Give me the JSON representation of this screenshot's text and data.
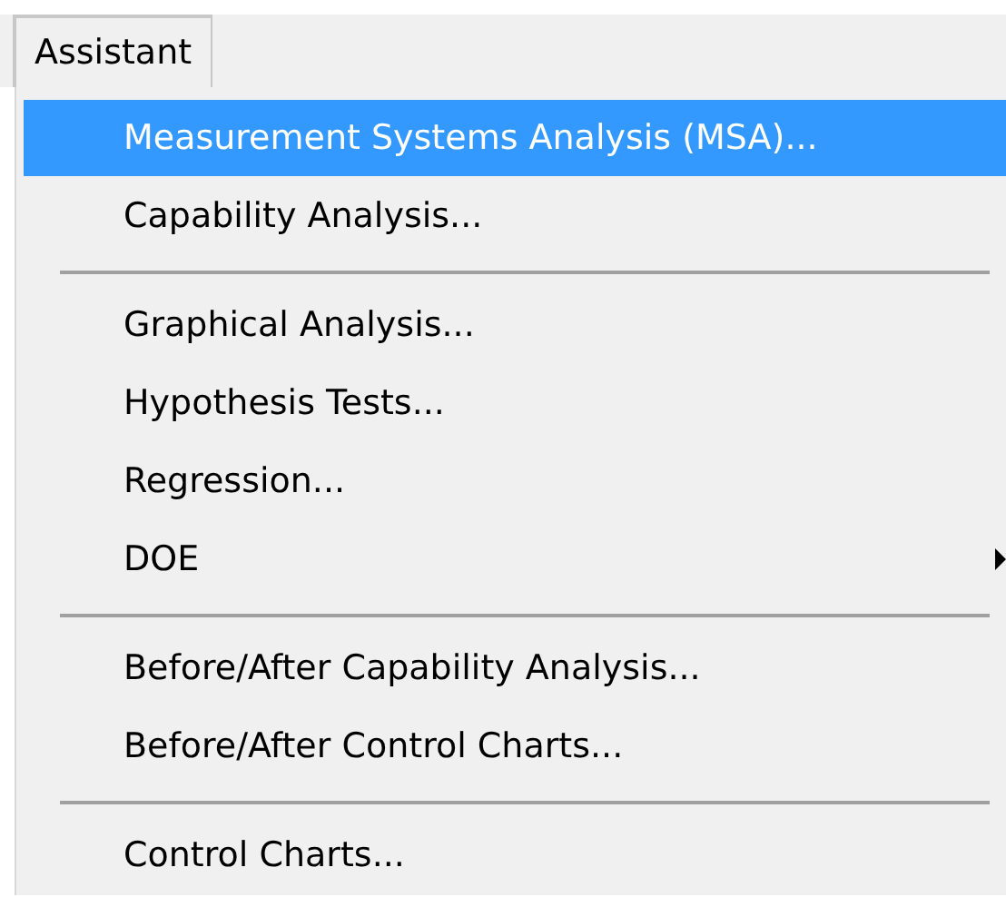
{
  "menu_bar": [
    {
      "label": "Assistant",
      "selected": true
    }
  ],
  "menu": {
    "items": [
      {
        "kind": "item",
        "label": "Measurement Systems Analysis (MSA)...",
        "selected": true,
        "has_submenu": false
      },
      {
        "kind": "item",
        "label": "Capability Analysis...",
        "selected": false,
        "has_submenu": false
      },
      {
        "kind": "separator"
      },
      {
        "kind": "item",
        "label": "Graphical Analysis...",
        "selected": false,
        "has_submenu": false
      },
      {
        "kind": "item",
        "label": "Hypothesis Tests...",
        "selected": false,
        "has_submenu": false
      },
      {
        "kind": "item",
        "label": "Regression...",
        "selected": false,
        "has_submenu": false
      },
      {
        "kind": "item",
        "label": "DOE",
        "selected": false,
        "has_submenu": true
      },
      {
        "kind": "separator"
      },
      {
        "kind": "item",
        "label": "Before/After Capability Analysis...",
        "selected": false,
        "has_submenu": false
      },
      {
        "kind": "item",
        "label": "Before/After Control Charts...",
        "selected": false,
        "has_submenu": false
      },
      {
        "kind": "separator"
      },
      {
        "kind": "item",
        "label": "Control Charts...",
        "selected": false,
        "has_submenu": false
      }
    ]
  }
}
